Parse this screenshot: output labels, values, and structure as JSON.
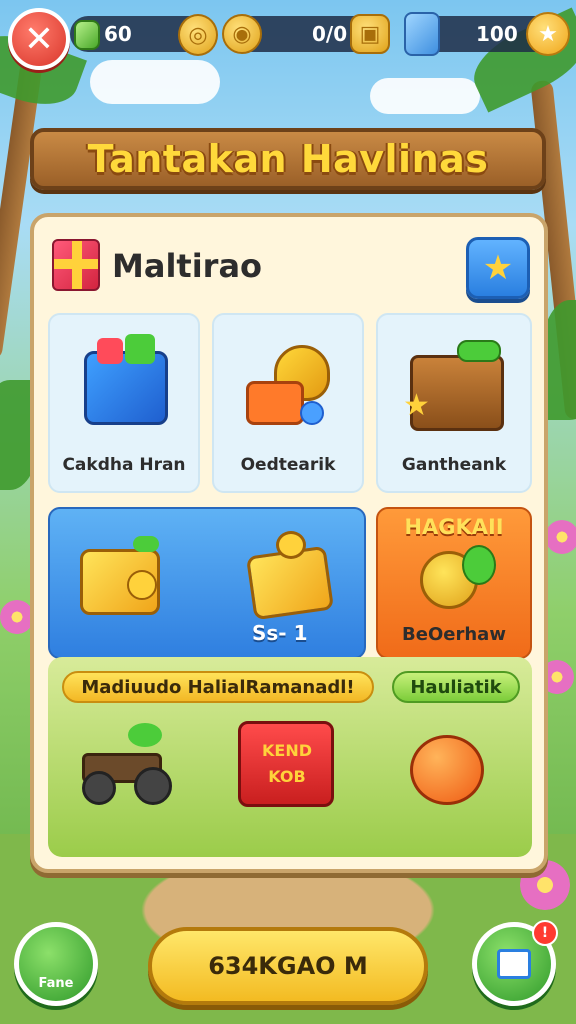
{
  "hud": {
    "close_icon": "✕",
    "resources": [
      {
        "icon": "gem-icon",
        "value": "60"
      },
      {
        "icon": "coin-icon",
        "value": ""
      },
      {
        "icon": "gold-coin-icon",
        "value": "0/0"
      },
      {
        "icon": "blue-gem-icon",
        "value": "100"
      }
    ]
  },
  "banner": {
    "title": "Tantakan Havlinas"
  },
  "panel": {
    "title": "Maltirao",
    "fav_icon": "★",
    "row1": [
      {
        "label": "Cakdha Hran"
      },
      {
        "label": "Oedtearik"
      },
      {
        "label": "Gantheank"
      }
    ],
    "row2": {
      "price": "Ss- 1",
      "offer_title": "HAGKAII",
      "offer_label": "BeOerhaw"
    },
    "strip": {
      "tag_left": "Madiuudo HalialRamanadl!",
      "tag_right": "Hauliatik",
      "chest_text": "KEND KOB"
    }
  },
  "footer": {
    "left_label": "Fane",
    "main_button": "634KGAO M",
    "badge": "!"
  },
  "colors": {
    "banner": "#9b6028",
    "title_text": "#ffd93b",
    "panel": "#fff6dc",
    "primary_button": "#f3bb22",
    "close": "#d9362b"
  }
}
